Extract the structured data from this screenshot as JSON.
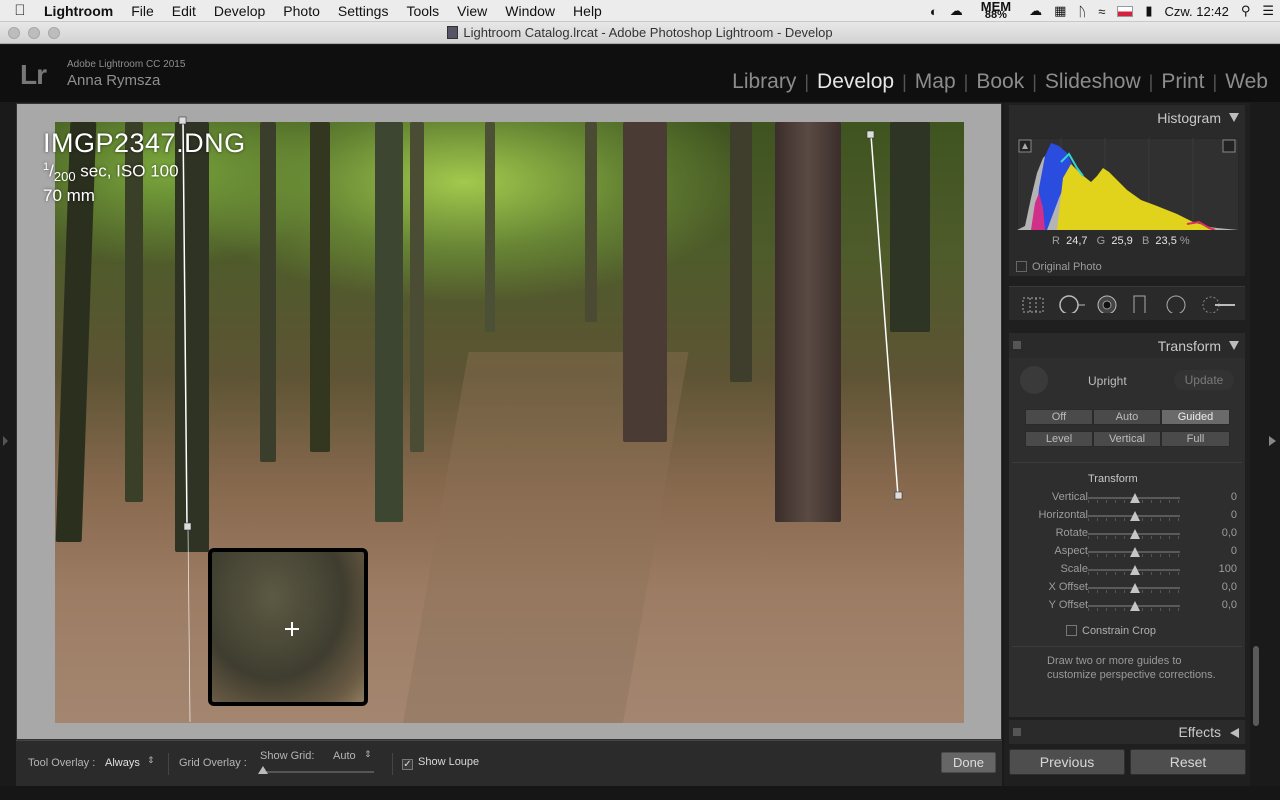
{
  "menubar": {
    "app": "Lightroom",
    "items": [
      "File",
      "Edit",
      "Develop",
      "Photo",
      "Settings",
      "Tools",
      "View",
      "Window",
      "Help"
    ],
    "mem_label": "MEM",
    "mem_value": "88%",
    "clock": "Czw. 12:42"
  },
  "window": {
    "title": "Lightroom Catalog.lrcat - Adobe Photoshop Lightroom - Develop"
  },
  "lrheader": {
    "logo": "Lr",
    "version": "Adobe Lightroom CC 2015",
    "user": "Anna Rymsza",
    "modules": [
      "Library",
      "Develop",
      "Map",
      "Book",
      "Slideshow",
      "Print",
      "Web"
    ],
    "active_module": "Develop"
  },
  "photo_info": {
    "filename": "IMGP2347.DNG",
    "exposure_num": "1",
    "exposure_den": "200",
    "exposure_rest": " sec, ISO 100",
    "focal": "70 mm"
  },
  "toolbar": {
    "tool_overlay_label": "Tool Overlay :",
    "tool_overlay_value": "Always",
    "grid_overlay_label": "Grid Overlay :",
    "show_grid_label": "Show Grid:",
    "show_grid_value": "Auto",
    "show_loupe_label": "Show Loupe",
    "done_label": "Done"
  },
  "histogram": {
    "title": "Histogram",
    "r_label": "R",
    "r_value": "24,7",
    "g_label": "G",
    "g_value": "25,9",
    "b_label": "B",
    "b_value": "23,5",
    "percent": "%",
    "original_photo": "Original Photo"
  },
  "transform": {
    "title": "Transform",
    "upright_label": "Upright",
    "update_label": "Update",
    "upright_buttons": [
      "Off",
      "Auto",
      "Guided",
      "Level",
      "Vertical",
      "Full"
    ],
    "selected_button": "Guided",
    "section_label": "Transform",
    "sliders": [
      {
        "label": "Vertical",
        "value": "0"
      },
      {
        "label": "Horizontal",
        "value": "0"
      },
      {
        "label": "Rotate",
        "value": "0,0"
      },
      {
        "label": "Aspect",
        "value": "0"
      },
      {
        "label": "Scale",
        "value": "100"
      },
      {
        "label": "X Offset",
        "value": "0,0"
      },
      {
        "label": "Y Offset",
        "value": "0,0"
      }
    ],
    "constrain_label": "Constrain Crop",
    "hint_line1": "Draw two or more guides to",
    "hint_line2": "customize perspective corrections."
  },
  "effects": {
    "title": "Effects"
  },
  "footer_buttons": {
    "previous": "Previous",
    "reset": "Reset"
  },
  "icons": [
    "apple-icon",
    "search-icon",
    "list-icon",
    "wifi-icon",
    "battery-icon",
    "bluetooth-icon",
    "crop-overlay-icon",
    "spot-removal-icon",
    "red-eye-icon",
    "graduated-filter-icon",
    "radial-filter-icon",
    "adjustment-brush-icon"
  ]
}
